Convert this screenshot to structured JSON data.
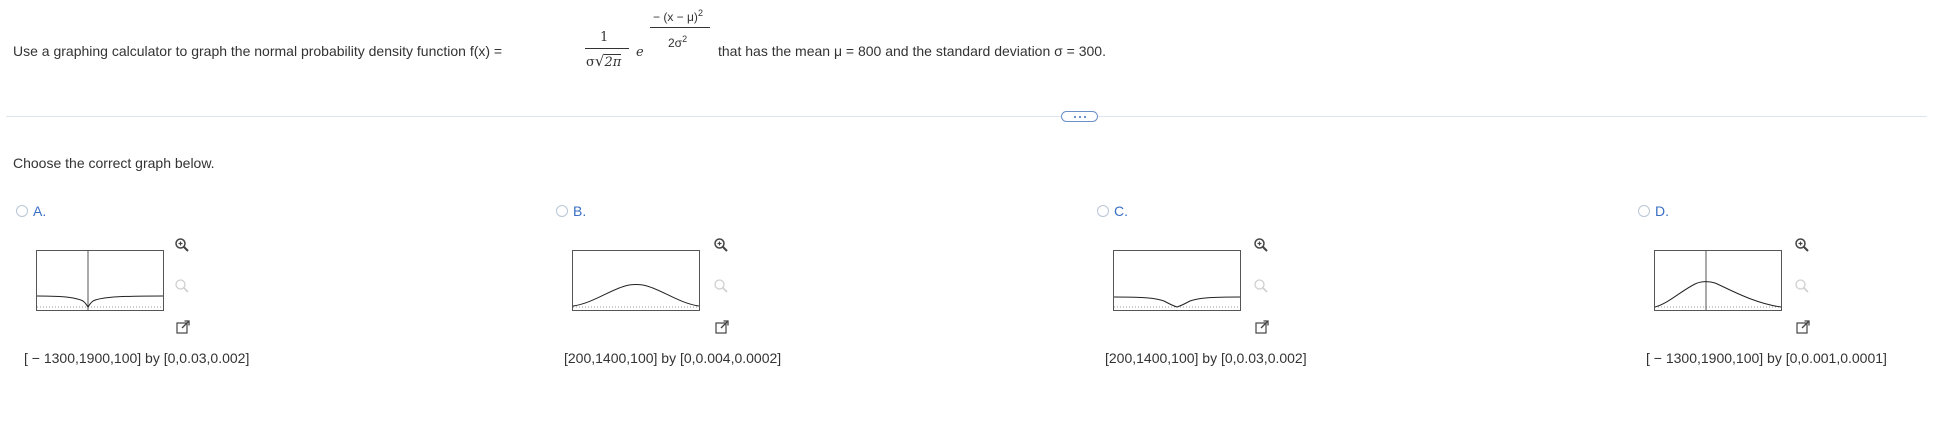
{
  "question": {
    "lead": "Use a graphing calculator to graph the normal probability density function f(x) =",
    "frac_numerator": "1",
    "frac_denominator_sigma": "σ",
    "frac_denominator_root": "2π",
    "base": "e",
    "exp_numerator": "− (x − μ)",
    "exp_numerator_power": "2",
    "exp_denominator": "2σ",
    "exp_denominator_power": "2",
    "tail": "that has the mean μ = 800 and the standard deviation σ = 300."
  },
  "prompt": "Choose the correct graph below.",
  "colors": {
    "accent": "#3a6fc4",
    "radio_border": "#b9c6d6",
    "divider": "#dde6f0",
    "text": "#333333"
  },
  "choices": [
    {
      "letter": "A.",
      "window": "[ − 1300,1900,100] by [0,0.03,0.002]",
      "curve": "inverted-dip",
      "y_axis_marker": true,
      "icons": [
        "zoom-in-icon",
        "zoom-out-icon",
        "open-external-icon"
      ]
    },
    {
      "letter": "B.",
      "window": "[200,1400,100] by [0,0.004,0.0002]",
      "curve": "bell",
      "y_axis_marker": false,
      "icons": [
        "zoom-in-icon",
        "zoom-out-icon",
        "open-external-icon"
      ]
    },
    {
      "letter": "C.",
      "window": "[200,1400,100] by [0,0.03,0.002]",
      "curve": "inverted-dip",
      "y_axis_marker": false,
      "icons": [
        "zoom-in-icon",
        "zoom-out-icon",
        "open-external-icon"
      ]
    },
    {
      "letter": "D.",
      "window": "[ − 1300,1900,100] by [0,0.001,0.0001]",
      "curve": "bell",
      "y_axis_marker": true,
      "icons": [
        "zoom-in-icon",
        "zoom-out-icon",
        "open-external-icon"
      ]
    }
  ]
}
